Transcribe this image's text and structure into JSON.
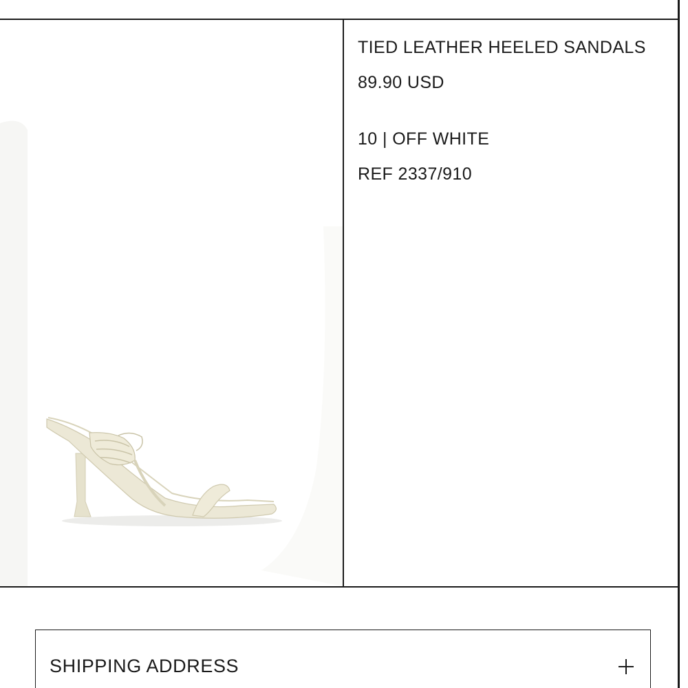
{
  "product": {
    "name": "TIED LEATHER HEELED SANDALS",
    "price": "89.90 USD",
    "variant": "10 | OFF WHITE",
    "reference": "REF 2337/910",
    "image_icon": "sandal-product-image",
    "color": "#ece8d6"
  },
  "shipping": {
    "label": "SHIPPING ADDRESS",
    "expand_icon": "plus-icon"
  }
}
